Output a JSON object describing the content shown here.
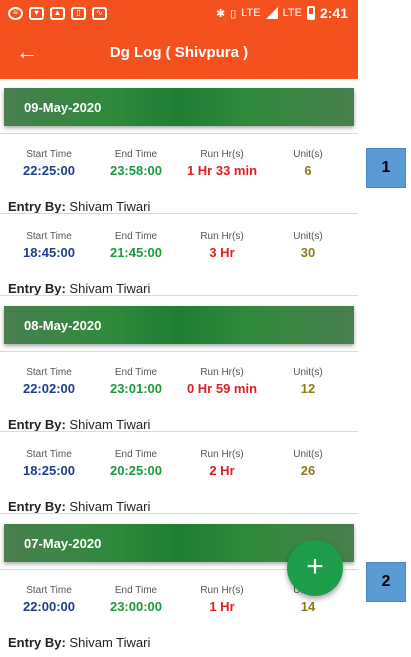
{
  "status_bar": {
    "time": "2:41",
    "lte_label": "LTE",
    "lte2_label": "LTE",
    "icons": [
      "spotify-icon",
      "heart-icon",
      "image-icon",
      "phone-icon",
      "activity-icon",
      "bluetooth-icon",
      "vibrate-icon",
      "call-lte-icon",
      "signal-icon",
      "signal-lte-icon",
      "battery-icon"
    ]
  },
  "app_bar": {
    "back_glyph": "←",
    "title": "Dg Log ( Shivpura )"
  },
  "colors": {
    "app_bar": "#f4511e",
    "date_band": "#2f8a3c",
    "start": "#1f3d8f",
    "end": "#1a9a3c",
    "run": "#e02020",
    "unit": "#8a7d1a",
    "fab": "#1e9e4a",
    "callout": "#5b9bd5"
  },
  "labels": {
    "start": "Start Time",
    "end": "End Time",
    "run": "Run Hr(s)",
    "unit": "Unit(s)",
    "entry_by": "Entry By:"
  },
  "groups": [
    {
      "date": "09-May-2020",
      "entries": [
        {
          "start": "22:25:00",
          "end": "23:58:00",
          "run": "1 Hr 33 min",
          "unit": "6",
          "entry_by": "Shivam Tiwari"
        },
        {
          "start": "18:45:00",
          "end": "21:45:00",
          "run": "3 Hr",
          "unit": "30",
          "entry_by": "Shivam Tiwari"
        }
      ]
    },
    {
      "date": "08-May-2020",
      "entries": [
        {
          "start": "22:02:00",
          "end": "23:01:00",
          "run": "0 Hr 59 min",
          "unit": "12",
          "entry_by": "Shivam Tiwari"
        },
        {
          "start": "18:25:00",
          "end": "20:25:00",
          "run": "2 Hr",
          "unit": "26",
          "entry_by": "Shivam Tiwari"
        }
      ]
    },
    {
      "date": "07-May-2020",
      "entries": [
        {
          "start": "22:00:00",
          "end": "23:00:00",
          "run": "1 Hr",
          "unit": "14",
          "entry_by": "Shivam Tiwari"
        }
      ]
    }
  ],
  "fab": {
    "glyph": "+"
  },
  "callouts": [
    "1",
    "2"
  ]
}
